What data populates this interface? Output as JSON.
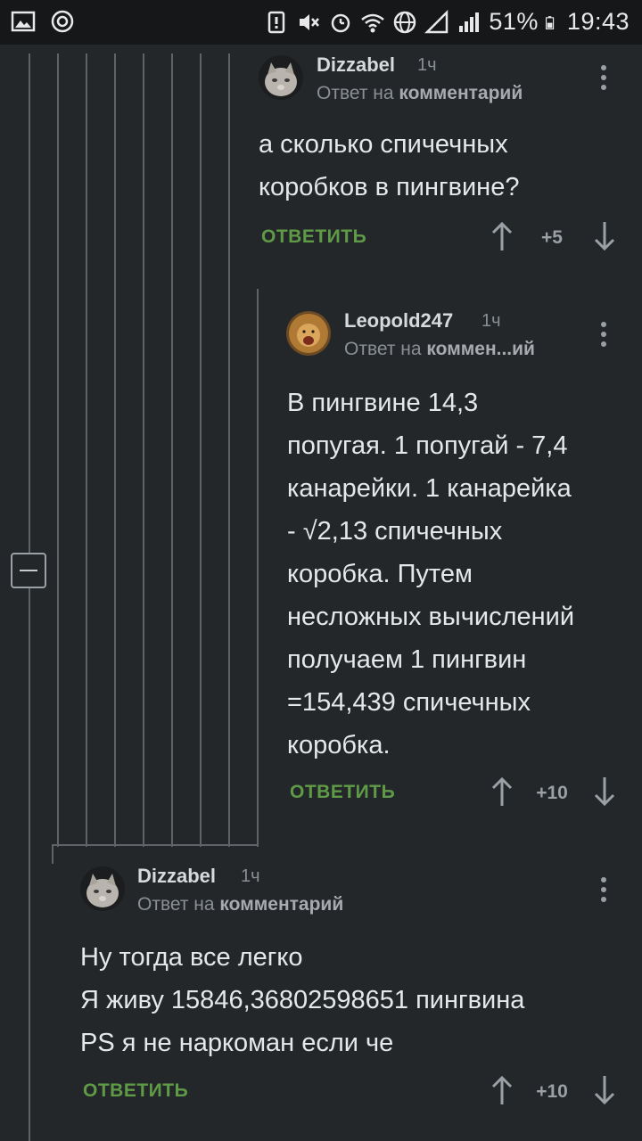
{
  "status_bar": {
    "battery_percent": "51%",
    "time": "19:43"
  },
  "comments": [
    {
      "author": "Dizzabel",
      "time": "1ч",
      "reply_prefix": "Ответ на ",
      "reply_target": "комментарий",
      "text": "а сколько спичечных\nкоробков в пингвине?",
      "reply_label": "ОТВЕТИТЬ",
      "score": "+5"
    },
    {
      "author": "Leopold247",
      "time": "1ч",
      "reply_prefix": "Ответ на ",
      "reply_target": "коммен...ий",
      "text": "В пингвине 14,3\nпопугая. 1 попугай - 7,4\nканарейки. 1 канарейка\n- √2,13 спичечных\nкоробка. Путем\nнесложных вычислений\nполучаем 1 пингвин\n=154,439 спичечных\nкоробка.",
      "reply_label": "ОТВЕТИТЬ",
      "score": "+10"
    },
    {
      "author": "Dizzabel",
      "time": "1ч",
      "reply_prefix": "Ответ на ",
      "reply_target": "комментарий",
      "text": "Ну тогда все легко\nЯ живу 15846,36802598651 пингвина\nPS я не наркоман если че",
      "reply_label": "ОТВЕТИТЬ",
      "score": "+10"
    }
  ]
}
